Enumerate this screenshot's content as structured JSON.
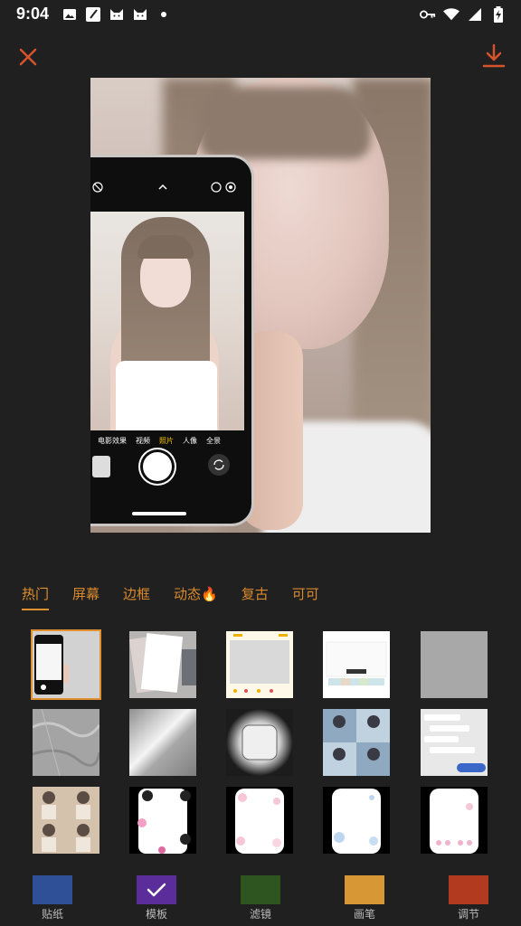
{
  "status_bar": {
    "time": "9:04",
    "left_icons": [
      "image-icon",
      "note-icon",
      "cat-icon",
      "cat-icon",
      "dot-icon"
    ],
    "right_icons": [
      "key-icon",
      "wifi-icon",
      "signal-icon",
      "battery-charging-icon"
    ]
  },
  "top_bar": {
    "close_icon": "close-icon",
    "download_icon": "download-icon",
    "accent_color": "#d4532b"
  },
  "preview": {
    "phone_modes": [
      "电影效果",
      "视频",
      "照片",
      "人像",
      "全景"
    ],
    "selected_mode": "照片"
  },
  "categories": [
    {
      "label": "热门",
      "active": true
    },
    {
      "label": "屏幕",
      "active": false
    },
    {
      "label": "边框",
      "active": false
    },
    {
      "label": "动态🔥",
      "active": false
    },
    {
      "label": "复古",
      "active": false
    },
    {
      "label": "可可",
      "active": false
    }
  ],
  "templates": [
    {
      "name": "phone-frame",
      "selected": true
    },
    {
      "name": "tilted-frames"
    },
    {
      "name": "notepad-frame"
    },
    {
      "name": "chat-screen"
    },
    {
      "name": "gray-blank"
    },
    {
      "name": "ice-texture"
    },
    {
      "name": "light-streak"
    },
    {
      "name": "rounded-square-glow"
    },
    {
      "name": "photo-collage"
    },
    {
      "name": "chat-bubbles"
    },
    {
      "name": "sepia-collage"
    },
    {
      "name": "kuromi-frame"
    },
    {
      "name": "pink-cute-frame"
    },
    {
      "name": "blue-cute-frame"
    },
    {
      "name": "pink-phone-frame"
    }
  ],
  "toolbar": {
    "items": [
      {
        "label": "贴纸",
        "color": "#2f4f97"
      },
      {
        "label": "模板",
        "color": "#5b2d9a"
      },
      {
        "label": "滤镜",
        "color": "#2e5520"
      },
      {
        "label": "画笔",
        "color": "#d89735"
      },
      {
        "label": "调节",
        "color": "#b23a1f"
      }
    ]
  }
}
